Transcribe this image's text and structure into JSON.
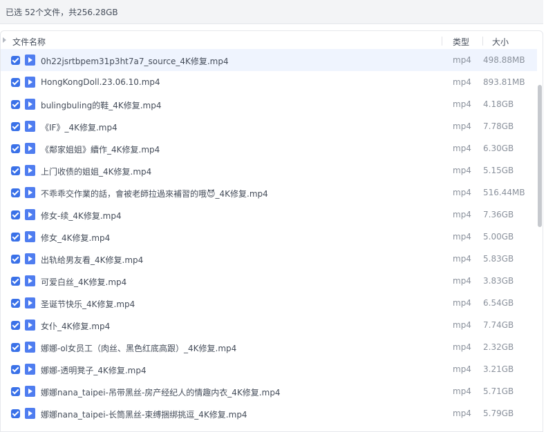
{
  "summary": "已选 52个文件，共256.28GB",
  "header": {
    "name_label": "文件名称",
    "type_label": "类型",
    "size_label": "大小"
  },
  "files": [
    {
      "name": "0h22jsrtbpem31p3ht7a7_source_4K修复.mp4",
      "type": "mp4",
      "size": "498.88MB"
    },
    {
      "name": "HongKongDoll.23.06.10.mp4",
      "type": "mp4",
      "size": "893.81MB"
    },
    {
      "name": "bulingbuling的鞋_4K修复.mp4",
      "type": "mp4",
      "size": "4.18GB"
    },
    {
      "name": "《IF》_4K修复.mp4",
      "type": "mp4",
      "size": "7.78GB"
    },
    {
      "name": "《鄰家姐姐》續作_4K修复.mp4",
      "type": "mp4",
      "size": "6.30GB"
    },
    {
      "name": "上门收债的姐姐_4K修复.mp4",
      "type": "mp4",
      "size": "5.15GB"
    },
    {
      "name": "不乖乖交作業的話，會被老師拉過來補習的哦😈_4K修复.mp4",
      "type": "mp4",
      "size": "516.44MB"
    },
    {
      "name": "修女-续_4K修复.mp4",
      "type": "mp4",
      "size": "7.36GB"
    },
    {
      "name": "修女_4K修复.mp4",
      "type": "mp4",
      "size": "5.00GB"
    },
    {
      "name": "出轨给男友看_4K修复.mp4",
      "type": "mp4",
      "size": "5.83GB"
    },
    {
      "name": "可爱白丝_4K修复.mp4",
      "type": "mp4",
      "size": "3.83GB"
    },
    {
      "name": "圣诞节快乐_4K修复.mp4",
      "type": "mp4",
      "size": "6.54GB"
    },
    {
      "name": "女仆_4K修复.mp4",
      "type": "mp4",
      "size": "7.74GB"
    },
    {
      "name": "娜娜-ol女员工（肉丝、黑色红底高跟）_4K修复.mp4",
      "type": "mp4",
      "size": "2.32GB"
    },
    {
      "name": "娜娜-透明凳子_4K修复.mp4",
      "type": "mp4",
      "size": "3.21GB"
    },
    {
      "name": "娜娜nana_taipei-吊带黑丝-房产经纪人的情趣内衣_4K修复.mp4",
      "type": "mp4",
      "size": "5.71GB"
    },
    {
      "name": "娜娜nana_taipei-长筒黑丝-束缚捆绑挑逗_4K修复.mp4",
      "type": "mp4",
      "size": "5.79GB"
    }
  ],
  "colors": {
    "checkbox": "#3a71e8",
    "file_icon": "#4f7df0",
    "highlight_row": "#eff4fe"
  },
  "icons": {
    "checkbox": "checkbox-checked-icon",
    "file": "video-file-icon",
    "header_toggle": "triangle-right-icon"
  }
}
